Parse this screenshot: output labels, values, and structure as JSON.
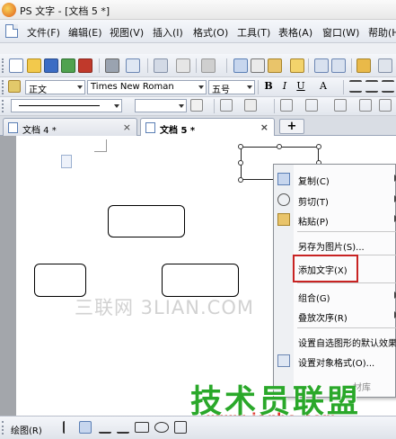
{
  "window": {
    "title": "PS 文字 - [文档 5 *]"
  },
  "menubar": {
    "items": [
      "文件(F)",
      "编辑(E)",
      "视图(V)",
      "插入(I)",
      "格式(O)",
      "工具(T)",
      "表格(A)",
      "窗口(W)",
      "帮助(H)"
    ]
  },
  "format_toolbar": {
    "style_value": "正文",
    "font_value": "Times New Roman",
    "size_value": "五号",
    "buttons": [
      "B",
      "I",
      "U",
      "A"
    ]
  },
  "tabs": [
    {
      "label": "文档 4 *",
      "close": "×",
      "active": false
    },
    {
      "label": "文档 5 *",
      "close": "×",
      "active": true
    }
  ],
  "new_tab": "+",
  "canvas": {
    "watermark": "三联网 3LIAN.COM"
  },
  "context_menu": {
    "items": [
      {
        "label": "复制(C)",
        "icon": "copy-icon"
      },
      {
        "label": "剪切(T)",
        "icon": "scissors-icon"
      },
      {
        "label": "粘贴(P)",
        "icon": "paste-icon"
      },
      {
        "label": "另存为图片(S)...",
        "icon": ""
      },
      {
        "label": "添加文字(X)",
        "icon": ""
      },
      {
        "label": "组合(G)",
        "icon": ""
      },
      {
        "label": "叠放次序(R)",
        "icon": ""
      },
      {
        "label": "设置自选图形的默认效果",
        "icon": ""
      },
      {
        "label": "设置对象格式(O)...",
        "icon": "format-object-icon"
      },
      {
        "label": "材库",
        "icon": ""
      }
    ]
  },
  "drawing_toolbar": {
    "label": "绘图(R)"
  },
  "brand_watermark": {
    "name": "技术员联盟",
    "url": "www.jsgho.com"
  },
  "colors": {
    "highlight_frame": "#c82323",
    "brand_green": "#2aa82a",
    "brand_red": "#e0352b"
  }
}
